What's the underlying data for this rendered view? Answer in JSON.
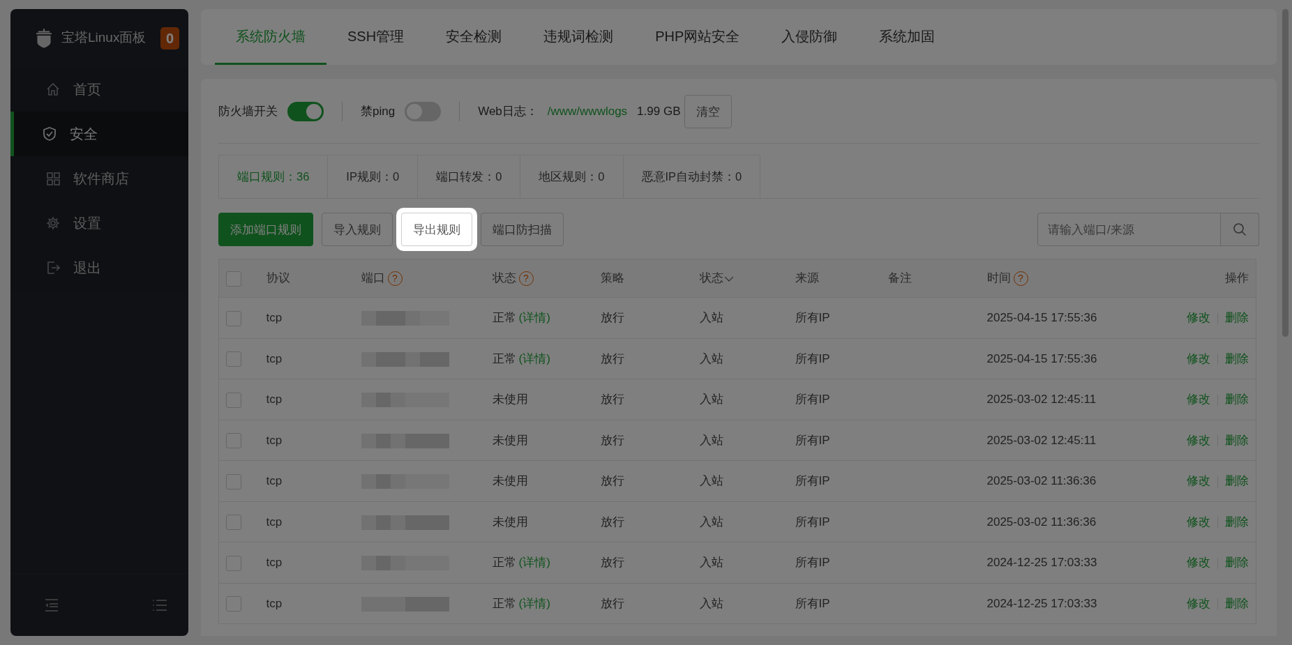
{
  "sidebar": {
    "brand": "宝塔Linux面板",
    "badge": "0",
    "items": [
      {
        "label": "首页",
        "selected": false
      },
      {
        "label": "安全",
        "selected": true
      },
      {
        "label": "软件商店",
        "selected": false
      },
      {
        "label": "设置",
        "selected": false
      },
      {
        "label": "退出",
        "selected": false
      }
    ]
  },
  "tabs": [
    {
      "label": "系统防火墙",
      "selected": true
    },
    {
      "label": "SSH管理",
      "selected": false
    },
    {
      "label": "安全检测",
      "selected": false
    },
    {
      "label": "违规词检测",
      "selected": false
    },
    {
      "label": "PHP网站安全",
      "selected": false
    },
    {
      "label": "入侵防御",
      "selected": false
    },
    {
      "label": "系统加固",
      "selected": false
    }
  ],
  "switches": [
    {
      "label": "防火墙开关",
      "on": true
    },
    {
      "label": "禁ping",
      "on": false
    }
  ],
  "web_log": {
    "label": "Web日志：",
    "path": "/www/wwwlogs",
    "size": "1.99 GB",
    "button": "清空"
  },
  "sub_tabs": [
    {
      "label": "端口规则：36",
      "selected": true
    },
    {
      "label": "IP规则：0",
      "selected": false
    },
    {
      "label": "端口转发：0",
      "selected": false
    },
    {
      "label": "地区规则：0",
      "selected": false
    },
    {
      "label": "恶意IP自动封禁：0",
      "selected": false
    }
  ],
  "actions": [
    {
      "label": "添加端口规则",
      "kind": "primary",
      "highlighted": false
    },
    {
      "label": "导入规则",
      "kind": "default",
      "highlighted": false
    },
    {
      "label": "导出规则",
      "kind": "default",
      "highlighted": true
    },
    {
      "label": "端口防扫描",
      "kind": "default",
      "highlighted": false
    }
  ],
  "search": {
    "placeholder": "请输入端口/来源"
  },
  "table": {
    "select_all": {
      "checked": false
    },
    "columns": [
      {
        "label": "协议"
      },
      {
        "label": "端口",
        "help": "?"
      },
      {
        "label": "状态",
        "help": "?"
      },
      {
        "label": "策略"
      },
      {
        "label": "状态",
        "sortable": true
      },
      {
        "label": "来源"
      },
      {
        "label": "备注"
      },
      {
        "label": "时间",
        "help": "?"
      },
      {
        "label": "操作"
      }
    ],
    "rows": [
      {
        "checked": false,
        "protocol": "tcp",
        "status": "正常",
        "detail": "(详情)",
        "policy": "放行",
        "direction": "入站",
        "source": "所有IP",
        "time": "2025-04-15 17:55:36",
        "edit": "修改",
        "delete": "删除"
      },
      {
        "checked": false,
        "protocol": "tcp",
        "status": "正常",
        "detail": "(详情)",
        "policy": "放行",
        "direction": "入站",
        "source": "所有IP",
        "time": "2025-04-15 17:55:36",
        "edit": "修改",
        "delete": "删除"
      },
      {
        "checked": false,
        "protocol": "tcp",
        "status": "未使用",
        "policy": "放行",
        "direction": "入站",
        "source": "所有IP",
        "time": "2025-03-02 12:45:11",
        "edit": "修改",
        "delete": "删除"
      },
      {
        "checked": false,
        "protocol": "tcp",
        "status": "未使用",
        "policy": "放行",
        "direction": "入站",
        "source": "所有IP",
        "time": "2025-03-02 12:45:11",
        "edit": "修改",
        "delete": "删除"
      },
      {
        "checked": false,
        "protocol": "tcp",
        "status": "未使用",
        "policy": "放行",
        "direction": "入站",
        "source": "所有IP",
        "time": "2025-03-02 11:36:36",
        "edit": "修改",
        "delete": "删除"
      },
      {
        "checked": false,
        "protocol": "tcp",
        "status": "未使用",
        "policy": "放行",
        "direction": "入站",
        "source": "所有IP",
        "time": "2025-03-02 11:36:36",
        "edit": "修改",
        "delete": "删除"
      },
      {
        "checked": false,
        "protocol": "tcp",
        "status": "正常",
        "detail": "(详情)",
        "policy": "放行",
        "direction": "入站",
        "source": "所有IP",
        "time": "2024-12-25 17:03:33",
        "edit": "修改",
        "delete": "删除"
      },
      {
        "checked": false,
        "protocol": "tcp",
        "status": "正常",
        "detail": "(详情)",
        "policy": "放行",
        "direction": "入站",
        "source": "所有IP",
        "time": "2024-12-25 17:03:33",
        "edit": "修改",
        "delete": "删除"
      }
    ]
  }
}
